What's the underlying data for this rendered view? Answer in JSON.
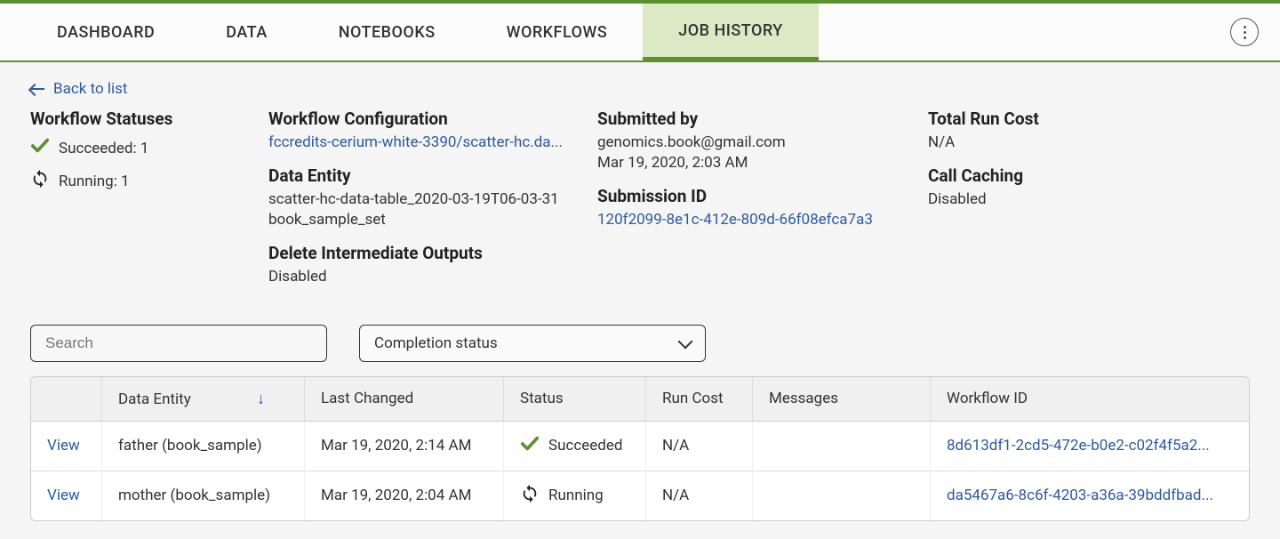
{
  "nav": {
    "tabs": [
      "DASHBOARD",
      "DATA",
      "NOTEBOOKS",
      "WORKFLOWS",
      "JOB HISTORY"
    ],
    "active_index": 4
  },
  "back_link": "Back to list",
  "statuses_title": "Workflow Statuses",
  "status_counts": {
    "succeeded": "Succeeded: 1",
    "running": "Running: 1"
  },
  "config": {
    "title": "Workflow Configuration",
    "value": "fccredits-cerium-white-3390/scatter-hc.da..."
  },
  "entity": {
    "title": "Data Entity",
    "line1": "scatter-hc-data-table_2020-03-19T06-03-31",
    "line2": "book_sample_set"
  },
  "delete_outputs": {
    "title": "Delete Intermediate Outputs",
    "value": "Disabled"
  },
  "submitted": {
    "title": "Submitted by",
    "email": "genomics.book@gmail.com",
    "date": "Mar 19, 2020, 2:03 AM"
  },
  "submission": {
    "title": "Submission ID",
    "id": "120f2099-8e1c-412e-809d-66f08efca7a3"
  },
  "cost": {
    "title": "Total Run Cost",
    "value": "N/A"
  },
  "caching": {
    "title": "Call Caching",
    "value": "Disabled"
  },
  "search": {
    "placeholder": "Search"
  },
  "select": {
    "label": "Completion status"
  },
  "table": {
    "headers": [
      "",
      "Data Entity",
      "Last Changed",
      "Status",
      "Run Cost",
      "Messages",
      "Workflow ID"
    ],
    "rows": [
      {
        "view": "View",
        "entity": "father (book_sample)",
        "changed": "Mar 19, 2020, 2:14 AM",
        "status": "Succeeded",
        "status_type": "succeeded",
        "cost": "N/A",
        "messages": "",
        "workflow_id": "8d613df1-2cd5-472e-b0e2-c02f4f5a2..."
      },
      {
        "view": "View",
        "entity": "mother (book_sample)",
        "changed": "Mar 19, 2020, 2:04 AM",
        "status": "Running",
        "status_type": "running",
        "cost": "N/A",
        "messages": "",
        "workflow_id": "da5467a6-8c6f-4203-a36a-39bddfbad..."
      }
    ]
  }
}
